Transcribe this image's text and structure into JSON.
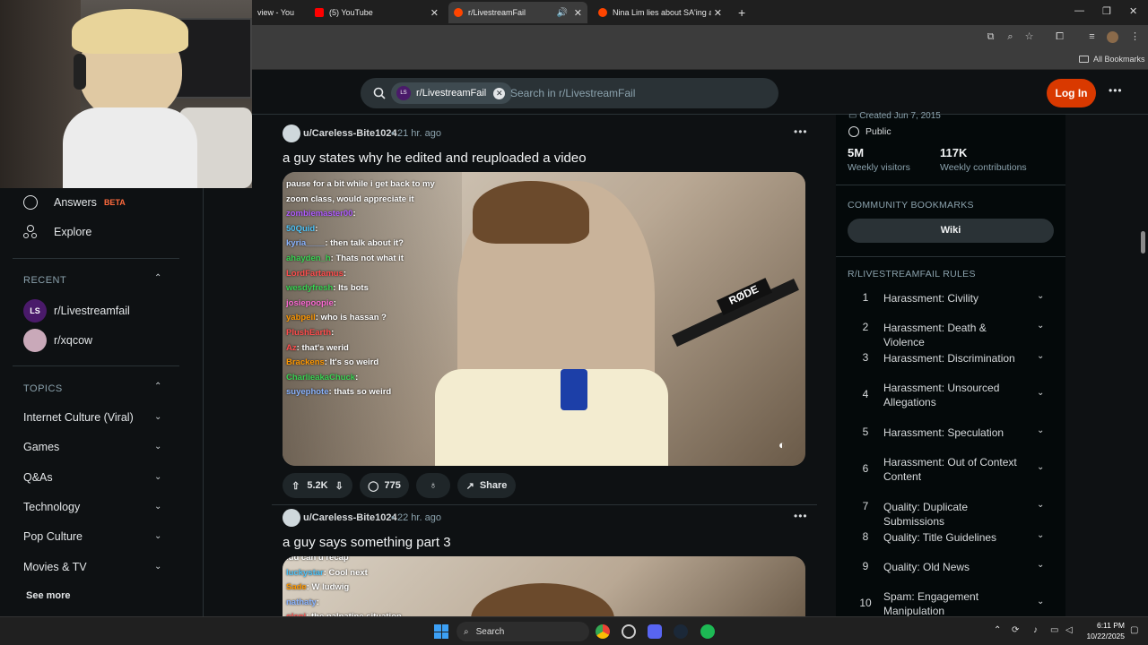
{
  "browser": {
    "tabs": [
      {
        "label": "view - You",
        "active": false
      },
      {
        "label": "(5) YouTube",
        "active": false
      },
      {
        "label": "r/LivestreamFail",
        "active": true
      },
      {
        "label": "Nina Lim lies about SA'ing ano",
        "active": false
      }
    ],
    "new_tab": "+",
    "bookmarks_label": "All Bookmarks"
  },
  "header": {
    "community_chip": "r/LivestreamFail",
    "chip_avatar": "LS",
    "search_placeholder": "Search in r/LivestreamFail",
    "login_label": "Log In",
    "more": "•••"
  },
  "left_sidebar": {
    "answers_label": "Answers",
    "answers_badge": "BETA",
    "explore_label": "Explore",
    "recent_title": "RECENT",
    "recent": [
      {
        "label": "r/Livestreamfail",
        "avatar": "LS"
      },
      {
        "label": "r/xqcow"
      }
    ],
    "topics_title": "TOPICS",
    "topics": [
      "Internet Culture (Viral)",
      "Games",
      "Q&As",
      "Technology",
      "Pop Culture",
      "Movies & TV"
    ],
    "see_more": "See more"
  },
  "feed": {
    "posts": [
      {
        "author": "u/Careless-Bite1024",
        "time": "21 hr. ago",
        "title": "a guy states why he edited and reuploaded a video",
        "upvotes": "5.2K",
        "comments": "775",
        "share": "Share",
        "chat": [
          {
            "user": "",
            "msg": "pause for a bit while i get back to my",
            "color": "#ffffff"
          },
          {
            "user": "",
            "msg": "zoom class, would appreciate it",
            "color": "#ffffff"
          },
          {
            "user": "zombiemaster00",
            "msg": "",
            "color": "#b05cff"
          },
          {
            "user": "50Quid",
            "msg": "",
            "color": "#4fc3f7"
          },
          {
            "user": "kyria____",
            "msg": "then talk about it?",
            "color": "#8ab4ff"
          },
          {
            "user": "ahayden_h",
            "msg": "Thats not what it",
            "color": "#39d353"
          },
          {
            "user": "LordFartamus",
            "msg": "",
            "color": "#ff4d4d"
          },
          {
            "user": "wesdyfresh",
            "msg": "Its bots",
            "color": "#39d353"
          },
          {
            "user": "josiepoopie",
            "msg": "",
            "color": "#ff6bd6"
          },
          {
            "user": "yabpeil",
            "msg": "who is hassan ?",
            "color": "#ff9800"
          },
          {
            "user": "PlushEarth",
            "msg": "",
            "color": "#ff4d4d"
          },
          {
            "user": "Az",
            "msg": "that's werid",
            "color": "#ff4d4d"
          },
          {
            "user": "Brackens",
            "msg": "It's so weird",
            "color": "#ff9800"
          },
          {
            "user": "CharlieakaChuck",
            "msg": "",
            "color": "#39d353"
          },
          {
            "user": "suyephote",
            "msg": "thats so weird",
            "color": "#8ab4ff"
          }
        ]
      },
      {
        "author": "u/Careless-Bite1024",
        "time": "22 hr. ago",
        "title": "a guy says something part 3",
        "chat": [
          {
            "user": "",
            "msg": "lud can u recap",
            "color": "#ffffff"
          },
          {
            "user": "luckystar",
            "msg": "Cool next",
            "color": "#4fc3f7"
          },
          {
            "user": "Sade",
            "msg": "W ludwig",
            "color": "#ff9800"
          },
          {
            "user": "nathaty",
            "msg": "",
            "color": "#8ab4ff"
          },
          {
            "user": "oleni",
            "msg": "the palpatine situation",
            "color": "#ff4d4d"
          }
        ]
      }
    ]
  },
  "right_sidebar": {
    "created": "Created Jun 7, 2015",
    "visibility": "Public",
    "visitors_value": "5M",
    "visitors_label": "Weekly visitors",
    "contrib_value": "117K",
    "contrib_label": "Weekly contributions",
    "bookmarks_title": "COMMUNITY BOOKMARKS",
    "wiki_label": "Wiki",
    "rules_title": "R/LIVESTREAMFAIL RULES",
    "rules": [
      {
        "n": "1",
        "text": "Harassment: Civility"
      },
      {
        "n": "2",
        "text": "Harassment: Death & Violence"
      },
      {
        "n": "3",
        "text": "Harassment: Discrimination"
      },
      {
        "n": "4",
        "text": "Harassment: Unsourced Allegations"
      },
      {
        "n": "5",
        "text": "Harassment: Speculation"
      },
      {
        "n": "6",
        "text": "Harassment: Out of Context Content"
      },
      {
        "n": "7",
        "text": "Quality: Duplicate Submissions"
      },
      {
        "n": "8",
        "text": "Quality: Title Guidelines"
      },
      {
        "n": "9",
        "text": "Quality: Old News"
      },
      {
        "n": "10",
        "text": "Spam: Engagement Manipulation"
      }
    ]
  },
  "taskbar": {
    "search_label": "Search",
    "time": "6:11 PM",
    "date": "10/22/2025"
  },
  "colors": {
    "accent": "#d93900",
    "bg": "#0e1113",
    "surface": "#1f2629"
  }
}
